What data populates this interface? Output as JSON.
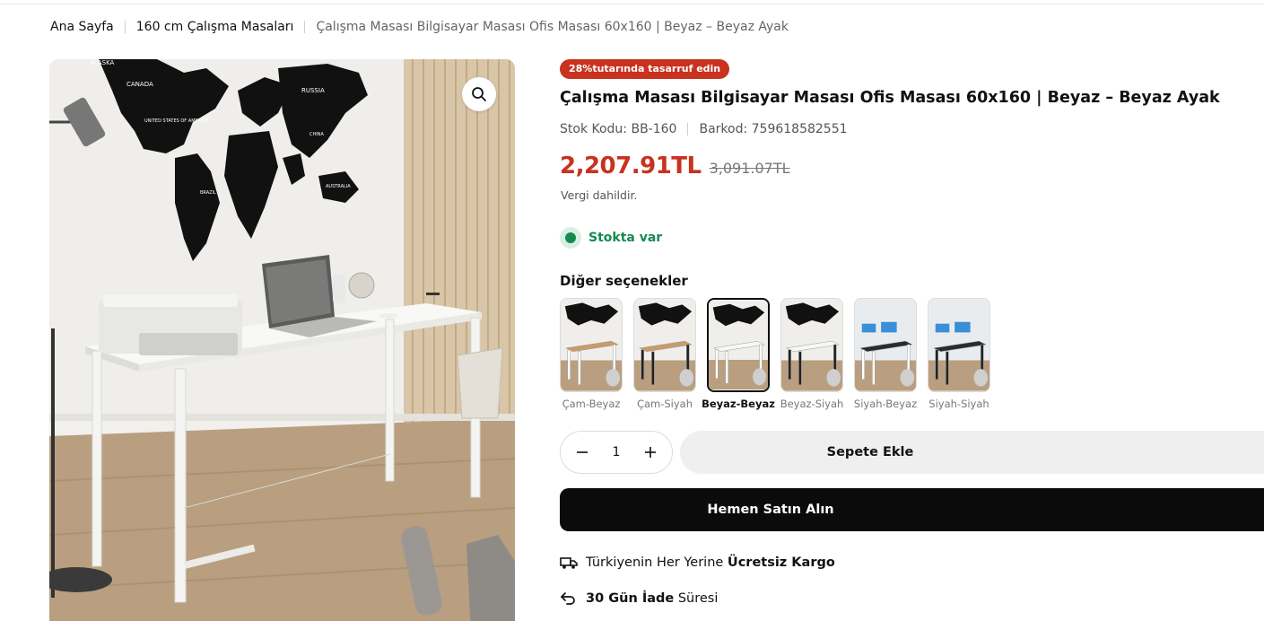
{
  "breadcrumb": {
    "home": "Ana Sayfa",
    "category": "160 cm Çalışma Masaları",
    "current": "Çalışma Masası Bilgisayar Masası Ofis Masası 60x160 | Beyaz – Beyaz Ayak"
  },
  "product": {
    "badge": "28%tutarında tasarruf edin",
    "title": "Çalışma Masası Bilgisayar Masası Ofis Masası 60x160 | Beyaz – Beyaz Ayak",
    "stock_code": "Stok Kodu: BB-160",
    "barcode": "Barkod: 759618582551",
    "price_now": "2,207.91TL",
    "price_old": "3,091.07TL",
    "tax_note": "Vergi dahildir.",
    "stock_status": "Stokta var",
    "options_title": "Diğer seçenekler",
    "options": [
      {
        "label": "Çam-Beyaz",
        "top": "#c99a6b",
        "leg": "#ffffff",
        "selected": false
      },
      {
        "label": "Çam-Siyah",
        "top": "#c99a6b",
        "leg": "#222222",
        "selected": false
      },
      {
        "label": "Beyaz-Beyaz",
        "top": "#f7f7f7",
        "leg": "#ffffff",
        "selected": true
      },
      {
        "label": "Beyaz-Siyah",
        "top": "#f7f7f7",
        "leg": "#222222",
        "selected": false
      },
      {
        "label": "Siyah-Beyaz",
        "top": "#2b2b2b",
        "leg": "#ffffff",
        "selected": false
      },
      {
        "label": "Siyah-Siyah",
        "top": "#2b2b2b",
        "leg": "#222222",
        "selected": false
      }
    ],
    "quantity": "1",
    "add_to_cart": "Sepete Ekle",
    "buy_now": "Hemen Satın Alın"
  },
  "features": {
    "shipping_prefix": "Türkiyenin Her Yerine ",
    "shipping_bold": "Ücretsiz Kargo",
    "return_bold": "30 Gün İade",
    "return_suffix": " Süresi"
  },
  "image": {
    "map_labels": [
      "ALASKA",
      "CANADA",
      "RUSSIA",
      "UNITED STATES OF AMERICA",
      "CHINA",
      "BRAZIL",
      "AUSTRALIA"
    ]
  },
  "icons": {
    "zoom": "magnifier-icon",
    "minus": "minus-icon",
    "plus": "plus-icon",
    "truck": "truck-icon",
    "return": "return-arrow-icon"
  },
  "colors": {
    "accent_red": "#c8321f",
    "stock_green": "#148a4f",
    "buy_button": "#0b0b0b"
  }
}
